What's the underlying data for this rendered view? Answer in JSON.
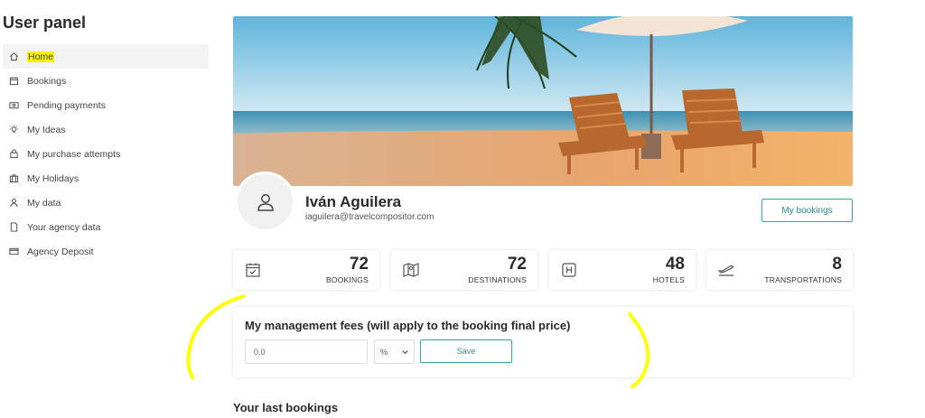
{
  "sidebar": {
    "title": "User panel",
    "items": [
      {
        "label": "Home",
        "icon": "home-icon",
        "active": true
      },
      {
        "label": "Bookings",
        "icon": "calendar-icon"
      },
      {
        "label": "Pending payments",
        "icon": "money-icon"
      },
      {
        "label": "My Ideas",
        "icon": "lightbulb-icon"
      },
      {
        "label": "My purchase attempts",
        "icon": "shopping-bag-icon"
      },
      {
        "label": "My Holidays",
        "icon": "suitcase-icon"
      },
      {
        "label": "My data",
        "icon": "user-icon"
      },
      {
        "label": "Your agency data",
        "icon": "document-icon"
      },
      {
        "label": "Agency Deposit",
        "icon": "credit-card-icon"
      }
    ]
  },
  "profile": {
    "name": "Iván Aguilera",
    "email": "iaguilera@travelcompositor.com",
    "my_bookings_label": "My bookings"
  },
  "stats": [
    {
      "value": "72",
      "label": "BOOKINGS",
      "icon": "calendar-check-icon"
    },
    {
      "value": "72",
      "label": "DESTINATIONS",
      "icon": "map-icon"
    },
    {
      "value": "48",
      "label": "HOTELS",
      "icon": "hotel-icon"
    },
    {
      "value": "8",
      "label": "TRANSPORTATIONS",
      "icon": "plane-icon"
    }
  ],
  "fees": {
    "title": "My management fees (will apply to the booking final price)",
    "input_value": "0,0",
    "unit_selected": "%",
    "save_label": "Save"
  },
  "last_bookings": {
    "title": "Your last bookings"
  },
  "colors": {
    "accent": "#39a6a6",
    "highlight": "#fff200",
    "annotation": "#ffff00"
  }
}
